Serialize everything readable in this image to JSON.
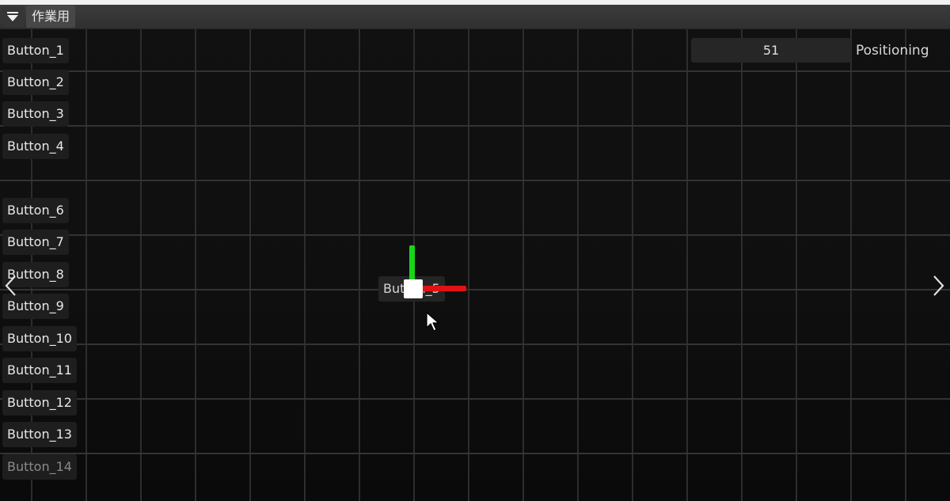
{
  "header": {
    "toggle_icon": "triangle-down-icon",
    "tab_title": "作業用"
  },
  "buttons": [
    {
      "label": "Button_1"
    },
    {
      "label": "Button_2"
    },
    {
      "label": "Button_3"
    },
    {
      "label": "Button_4"
    },
    {
      "label": "Button_6"
    },
    {
      "label": "Button_7"
    },
    {
      "label": "Button_8"
    },
    {
      "label": "Button_9"
    },
    {
      "label": "Button_10"
    },
    {
      "label": "Button_11"
    },
    {
      "label": "Button_12"
    },
    {
      "label": "Button_13"
    },
    {
      "label": "Button_14"
    }
  ],
  "controls": {
    "value": "51",
    "mode_label": "Positioning"
  },
  "selected": {
    "label": "Button_5"
  },
  "gizmo": {
    "y_axis_color": "#17d617",
    "x_axis_color": "#e31212",
    "handle_color": "#ffffff"
  },
  "icons": {
    "prev": "chevron-left-icon",
    "next": "chevron-right-icon",
    "cursor": "mouse-pointer-icon"
  }
}
